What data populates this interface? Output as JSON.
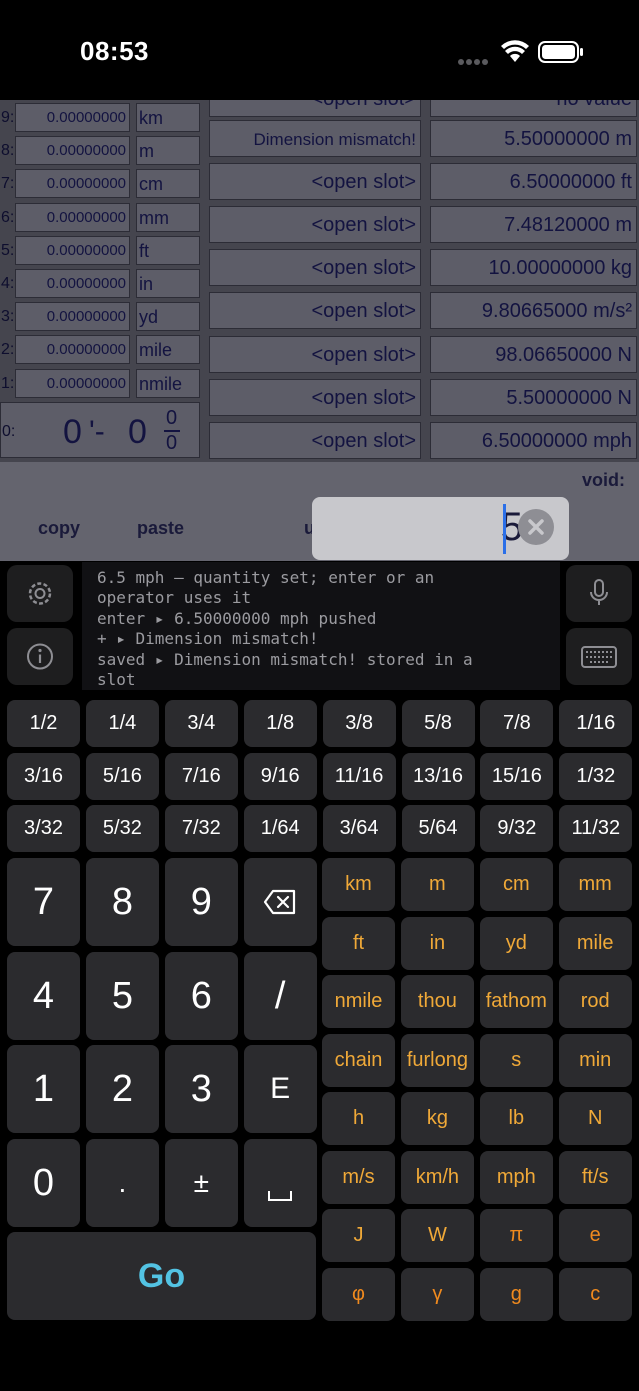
{
  "status_bar": {
    "time": "08:53"
  },
  "stack": [
    {
      "index": "9:",
      "value": "0.00000000",
      "unit": "km"
    },
    {
      "index": "8:",
      "value": "0.00000000",
      "unit": "m"
    },
    {
      "index": "7:",
      "value": "0.00000000",
      "unit": "cm"
    },
    {
      "index": "6:",
      "value": "0.00000000",
      "unit": "mm"
    },
    {
      "index": "5:",
      "value": "0.00000000",
      "unit": "ft"
    },
    {
      "index": "4:",
      "value": "0.00000000",
      "unit": "in"
    },
    {
      "index": "3:",
      "value": "0.00000000",
      "unit": "yd"
    },
    {
      "index": "2:",
      "value": "0.00000000",
      "unit": "mile"
    },
    {
      "index": "1:",
      "value": "0.00000000",
      "unit": "nmile"
    }
  ],
  "x_register": {
    "index": "0:",
    "feet": "0",
    "inch_mark": "'-",
    "inches": "0",
    "frac_num": "0",
    "frac_den": "0"
  },
  "slots": [
    "<open slot>",
    "Dimension mismatch!",
    "<open slot>",
    "<open slot>",
    "<open slot>",
    "<open slot>",
    "<open slot>",
    "<open slot>",
    "<open slot>"
  ],
  "registers": [
    "no value",
    "5.50000000 m",
    "6.50000000 ft",
    "7.48120000 m",
    "10.00000000 kg",
    "9.80665000 m/s²",
    "98.06650000 N",
    "5.50000000 N",
    "6.50000000 mph"
  ],
  "toolbar": {
    "copy": "copy",
    "paste": "paste",
    "void_label": "void:"
  },
  "entry": {
    "value": "5"
  },
  "log_lines": [
    "6.5 mph — quantity set; enter or an",
    "operator uses it",
    "enter ▸ 6.50000000 mph pushed",
    "+ ▸ Dimension mismatch!",
    "saved ▸ Dimension mismatch! stored in a",
    "slot"
  ],
  "fractions": [
    "1/2",
    "1/4",
    "3/4",
    "1/8",
    "3/8",
    "5/8",
    "7/8",
    "1/16",
    "3/16",
    "5/16",
    "7/16",
    "9/16",
    "11/16",
    "13/16",
    "15/16",
    "1/32",
    "3/32",
    "5/32",
    "7/32",
    "1/64",
    "3/64",
    "5/64",
    "9/32",
    "11/32"
  ],
  "numpad": [
    "7",
    "8",
    "9",
    "⌫",
    "4",
    "5",
    "6",
    "/",
    "1",
    "2",
    "3",
    "E",
    "0",
    ".",
    "±",
    "␣"
  ],
  "units": [
    [
      "km",
      "m",
      "cm",
      "mm"
    ],
    [
      "ft",
      "in",
      "yd",
      "mile"
    ],
    [
      "nmile",
      "thou",
      "fathom",
      "rod"
    ],
    [
      "chain",
      "furlong",
      "s",
      "min"
    ],
    [
      "h",
      "kg",
      "lb",
      "N"
    ],
    [
      "m/s",
      "km/h",
      "mph",
      "ft/s"
    ],
    [
      "J",
      "W",
      "π",
      "e"
    ],
    [
      "φ",
      "γ",
      "g",
      "c"
    ]
  ],
  "go_label": "Go",
  "colors": {
    "unit_text": "#f0a938",
    "constant_text": "#f08a1e",
    "go_text": "#53c3e3",
    "cursor": "#2b6fe8"
  }
}
